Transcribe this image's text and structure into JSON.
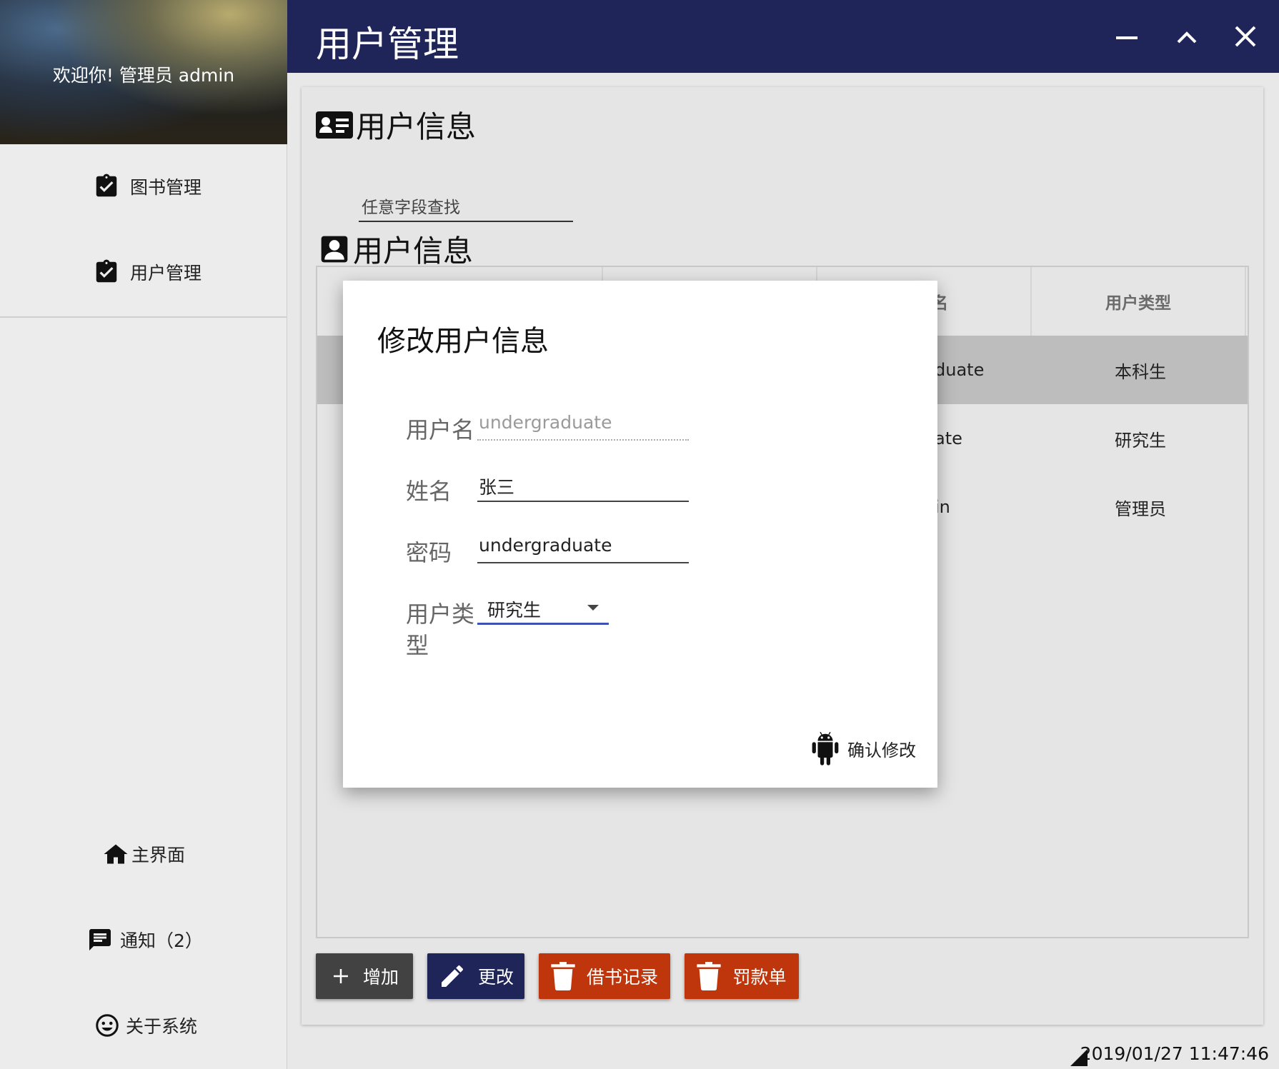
{
  "profile": {
    "welcome": "欢迎你!  管理员 admin"
  },
  "sidebar": {
    "items": [
      {
        "label": "图书管理",
        "icon": "clipboard-check-icon"
      },
      {
        "label": "用户管理",
        "icon": "clipboard-check-icon"
      }
    ],
    "bottom": [
      {
        "label": "主界面",
        "icon": "home-icon"
      },
      {
        "label": "通知（2）",
        "icon": "message-icon"
      },
      {
        "label": "关于系统",
        "icon": "smile-icon"
      }
    ]
  },
  "titlebar": {
    "title": "用户管理"
  },
  "main": {
    "section_title": "用户信息",
    "search_placeholder": "任意字段查找",
    "table_title": "用户信息",
    "columns": [
      "",
      "",
      "名",
      "用户类型"
    ],
    "rows": [
      {
        "c3": "duate",
        "c4": "本科生"
      },
      {
        "c3": "ate",
        "c4": "研究生"
      },
      {
        "c3": "in",
        "c4": "管理员"
      }
    ]
  },
  "buttons": {
    "add": "增加",
    "edit": "更改",
    "borrow_records": "借书记录",
    "fines": "罚款单"
  },
  "colors": {
    "titlebar": "#1f2558",
    "add": "#424242",
    "edit": "#1f2558",
    "danger": "#c0360c",
    "accent": "#3f51b5"
  },
  "dialog": {
    "title": "修改用户信息",
    "username_label": "用户名",
    "username_value": "undergraduate",
    "name_label": "姓名",
    "name_value": "张三",
    "password_label": "密码",
    "password_value": "undergraduate",
    "type_label_line1": "用户类",
    "type_label_line2": "型",
    "type_value": "研究生",
    "confirm": "确认修改"
  },
  "status": {
    "datetime": "2019/01/27 11:47:46"
  }
}
